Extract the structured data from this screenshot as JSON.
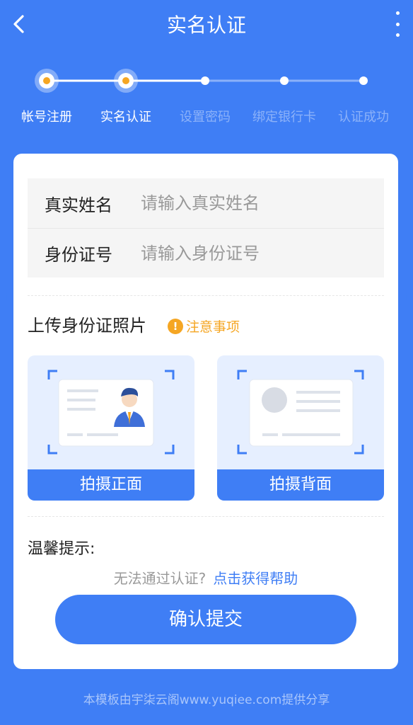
{
  "header": {
    "title": "实名认证",
    "back_icon": "chevron-left-icon",
    "menu_icon": "more-vertical-icon"
  },
  "steps": [
    {
      "label": "帐号注册",
      "state": "done"
    },
    {
      "label": "实名认证",
      "state": "active"
    },
    {
      "label": "设置密码",
      "state": "pending"
    },
    {
      "label": "绑定银行卡",
      "state": "pending"
    },
    {
      "label": "认证成功",
      "state": "pending"
    }
  ],
  "form": {
    "name_label": "真实姓名",
    "name_placeholder": "请输入真实姓名",
    "id_label": "身份证号",
    "id_placeholder": "请输入身份证号"
  },
  "upload": {
    "title": "上传身份证照片",
    "notice": "注意事项",
    "front_label": "拍摄正面",
    "back_label": "拍摄背面"
  },
  "tips": {
    "title": "温馨提示:",
    "question": "无法通过认证?",
    "help_link": "点击获得帮助"
  },
  "submit_label": "确认提交",
  "footer": "本模板由宇柒云阁www.yuqiee.com提供分享",
  "colors": {
    "primary": "#3f7ef5",
    "warning": "#f5a623",
    "step_dot": "#f5a623"
  }
}
